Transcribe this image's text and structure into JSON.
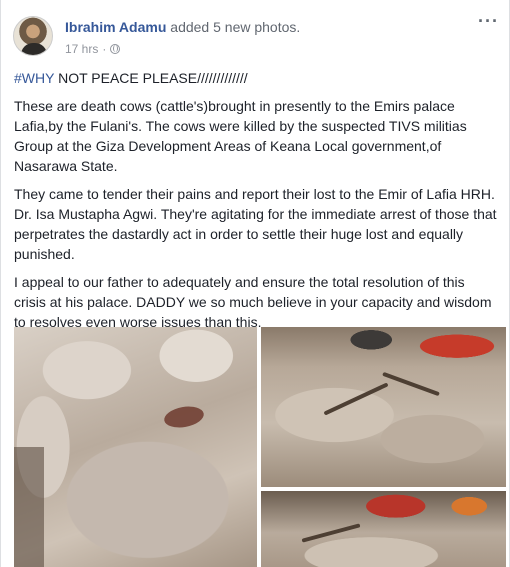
{
  "post": {
    "author": "Ibrahim Adamu",
    "action": "added 5 new photos.",
    "time": "17 hrs",
    "meta_separator": "·",
    "more_label": "···",
    "paragraphs": {
      "p0_hashtag": "#WHY",
      "p0_rest": " NOT PEACE PLEASE/////////////",
      "p1": "These are death cows (cattle's)brought in presently to the Emirs palace Lafia,by the Fulani's. The cows were killed by the suspected TIVS militias Group at the Giza Development Areas of Keana Local government,of Nasarawa State.",
      "p2": "They came to tender their pains and report their lost to the Emir of Lafia HRH. Dr. Isa Mustapha Agwi. They're agitating for the immediate arrest of those that perpetrates the dastardly act in order to settle their huge lost and equally punished.",
      "p3": "I appeal to our father to adequately and ensure the total resolution of this crisis at his palace. DADDY we so much believe in your capacity and wisdom to resolves even worse issues than this."
    }
  },
  "colors": {
    "link": "#365899",
    "text": "#1d2129",
    "meta": "#90949c"
  },
  "icons": {
    "privacy": "globe-icon",
    "options": "more-icon"
  }
}
